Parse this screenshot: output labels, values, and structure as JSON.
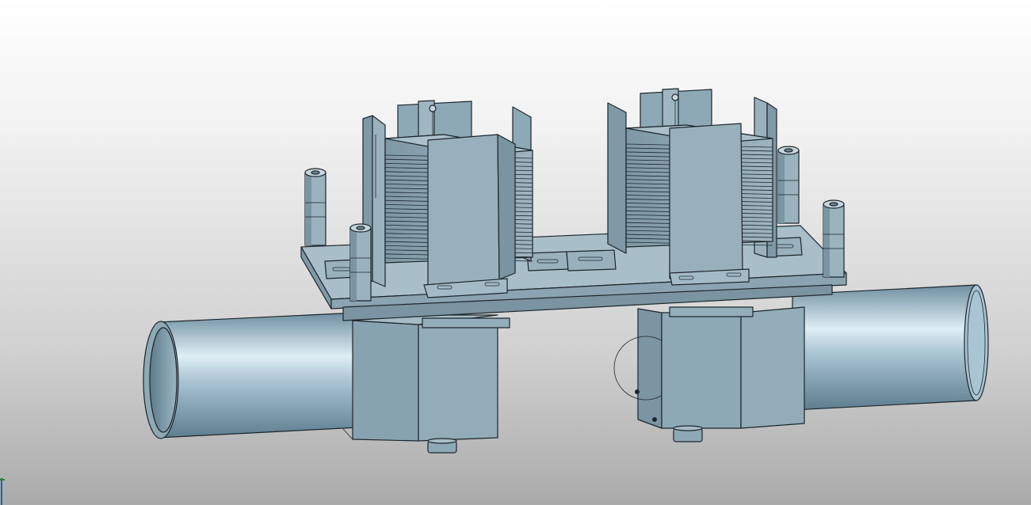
{
  "viewport": {
    "background_top": "#ffffff",
    "background_bottom": "#aaaaaa"
  },
  "model": {
    "base_color": "#8ea9b6",
    "light_color": "#b3c8d2",
    "dark_color": "#6e8896",
    "edge_color": "#1d262c"
  },
  "axis_triad": {
    "x_color": "#1565c0",
    "y_color": "#2e7d32"
  }
}
